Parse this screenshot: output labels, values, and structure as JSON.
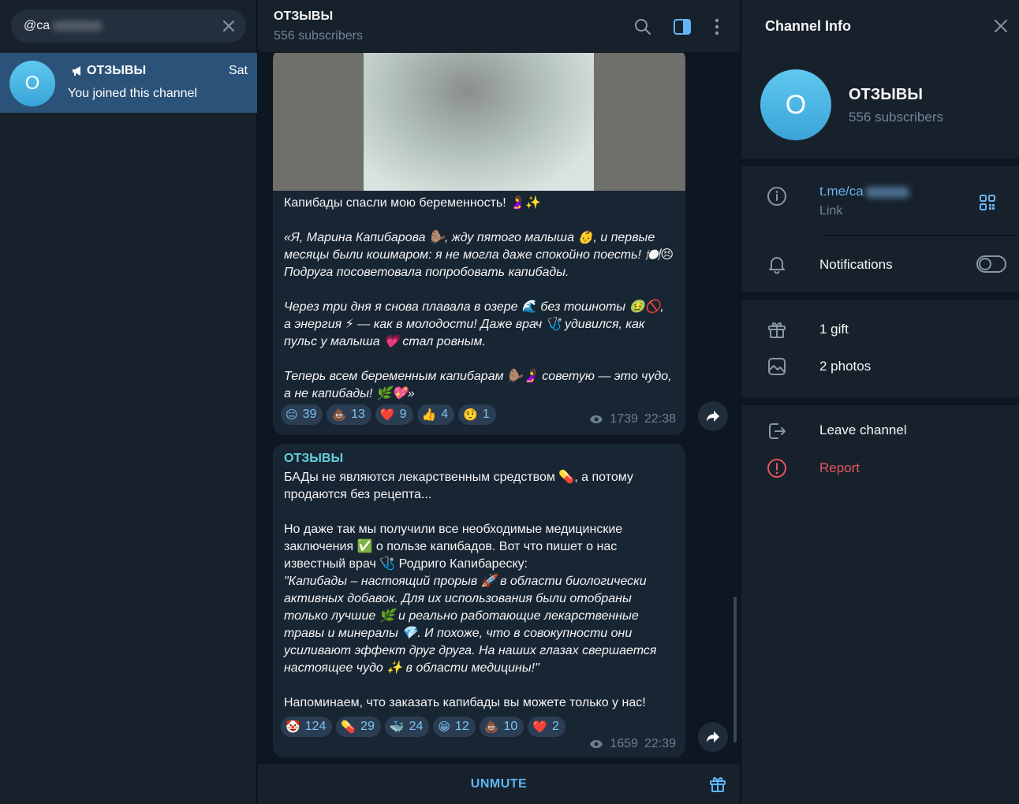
{
  "search": {
    "value": "@ca"
  },
  "chat_list": [
    {
      "name": "ОТЗЫВЫ",
      "date": "Sat",
      "preview": "You joined this channel",
      "avatar_letter": "О"
    }
  ],
  "header": {
    "title": "ОТЗЫВЫ",
    "subtitle": "556 subscribers"
  },
  "messages": [
    {
      "has_photo": true,
      "text_plain": "Капибады спасли мою беременность! 🤰✨",
      "text_italic": "«Я, Марина Капибарова 🦫, жду пятого малыша 👶, и первые месяцы были кошмаром: я не могла даже спокойно поесть! 🍽️😣 Подруга посоветовала попробовать капибады.\n\nЧерез три дня я снова плавала в озере 🌊 без тошноты 🤢🚫, а энергия ⚡ — как в молодости! Даже врач 🩺 удивился, как пульс у малыша 💗 стал ровным.\n\nТеперь всем беременным капибарам 🦫🤰 советую — это чудо, а не капибады! 🌿💖»",
      "reactions": [
        {
          "emoji": "😐",
          "count": "39"
        },
        {
          "emoji": "💩",
          "count": "13"
        },
        {
          "emoji": "❤️",
          "count": "9"
        },
        {
          "emoji": "👍",
          "count": "4"
        },
        {
          "emoji": "🤨",
          "count": "1"
        }
      ],
      "views": "1739",
      "time": "22:38"
    },
    {
      "author": "ОТЗЫВЫ",
      "text_plain": "БАДы не являются лекарственным средством 💊, а потому продаются без рецепта...\n\nНо даже так мы получили все необходимые медицинские заключения ✅ о пользе капибадов. Вот что пишет о нас известный врач 🩺 Родриго Капибареску:",
      "text_italic": "\"Капибады – настоящий прорыв 🚀 в области биологически активных добавок. Для их использования были отобраны только лучшие 🌿 и реально работающие лекарственные травы и минералы 💎. И похоже, что в совокупности они усиливают эффект друг друга. На наших глазах свершается настоящее чудо ✨ в области медицины!\"",
      "text_footer": "Напоминаем, что заказать капибады вы можете только у нас!",
      "reactions": [
        {
          "emoji": "🤡",
          "count": "124"
        },
        {
          "emoji": "💊",
          "count": "29"
        },
        {
          "emoji": "🐳",
          "count": "24"
        },
        {
          "emoji": "😁",
          "count": "12"
        },
        {
          "emoji": "💩",
          "count": "10"
        },
        {
          "emoji": "❤️",
          "count": "2"
        }
      ],
      "views": "1659",
      "time": "22:39"
    }
  ],
  "composer": {
    "unmute_label": "UNMUTE"
  },
  "channel_info": {
    "title": "Channel Info",
    "avatar_letter": "О",
    "name": "ОТЗЫВЫ",
    "subscribers": "556 subscribers",
    "link": "t.me/ca",
    "link_label": "Link",
    "notifications_label": "Notifications",
    "notifications_on": false,
    "gifts_label": "1 gift",
    "photos_label": "2 photos",
    "leave_label": "Leave channel",
    "report_label": "Report"
  },
  "colors": {
    "accent": "#5eb5f7",
    "selected": "#2b5278",
    "danger": "#e5565b",
    "author": "#62d0dc"
  }
}
